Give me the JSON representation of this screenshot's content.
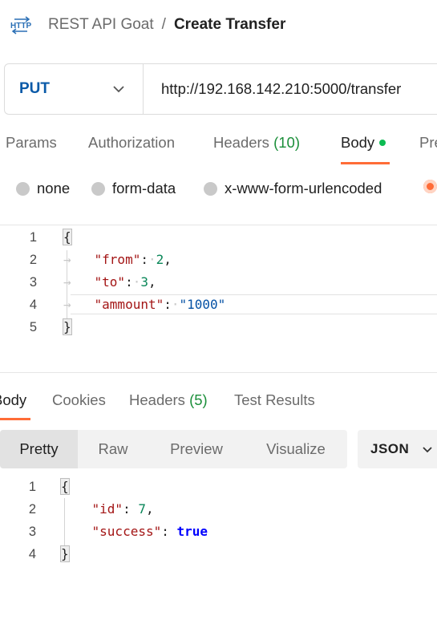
{
  "header": {
    "icon": "http-request-icon",
    "collection": "REST API Goat",
    "separator": "/",
    "request_name": "Create Transfer"
  },
  "request": {
    "method": "PUT",
    "url": "http://192.168.142.210:5000/transfer"
  },
  "request_tabs": [
    {
      "label": "Params"
    },
    {
      "label": "Authorization"
    },
    {
      "label": "Headers",
      "count": "(10)"
    },
    {
      "label": "Body",
      "active": true,
      "indicator": "green-dot"
    },
    {
      "label": "Pre"
    }
  ],
  "body_types": [
    {
      "label": "none"
    },
    {
      "label": "form-data"
    },
    {
      "label": "x-www-form-urlencoded"
    },
    {
      "label": "",
      "selected": true
    }
  ],
  "request_body": {
    "line_numbers": [
      "1",
      "2",
      "3",
      "4",
      "5"
    ],
    "open_brace": "{",
    "close_brace": "}",
    "fields": [
      {
        "key": "\"from\"",
        "value": "2",
        "comma": ","
      },
      {
        "key": "\"to\"",
        "value": "3",
        "comma": ","
      },
      {
        "key": "\"ammount\"",
        "value": "\"1000\"",
        "comma": ""
      }
    ]
  },
  "response_tabs": [
    {
      "label": "Body",
      "active": true
    },
    {
      "label": "Cookies"
    },
    {
      "label": "Headers",
      "count": "(5)"
    },
    {
      "label": "Test Results"
    }
  ],
  "response_views": [
    {
      "label": "Pretty",
      "active": true
    },
    {
      "label": "Raw"
    },
    {
      "label": "Preview"
    },
    {
      "label": "Visualize"
    }
  ],
  "response_format": "JSON",
  "response_body": {
    "line_numbers": [
      "1",
      "2",
      "3",
      "4"
    ],
    "open_brace": "{",
    "close_brace": "}",
    "fields": [
      {
        "key": "\"id\"",
        "value": "7",
        "comma": ","
      },
      {
        "key": "\"success\"",
        "value": "true",
        "comma": ""
      }
    ]
  },
  "colors": {
    "accent": "#ff6c37",
    "method_put": "#0a5aa8",
    "count_green": "#1b8f3a",
    "body_dot": "#0cbb52"
  }
}
